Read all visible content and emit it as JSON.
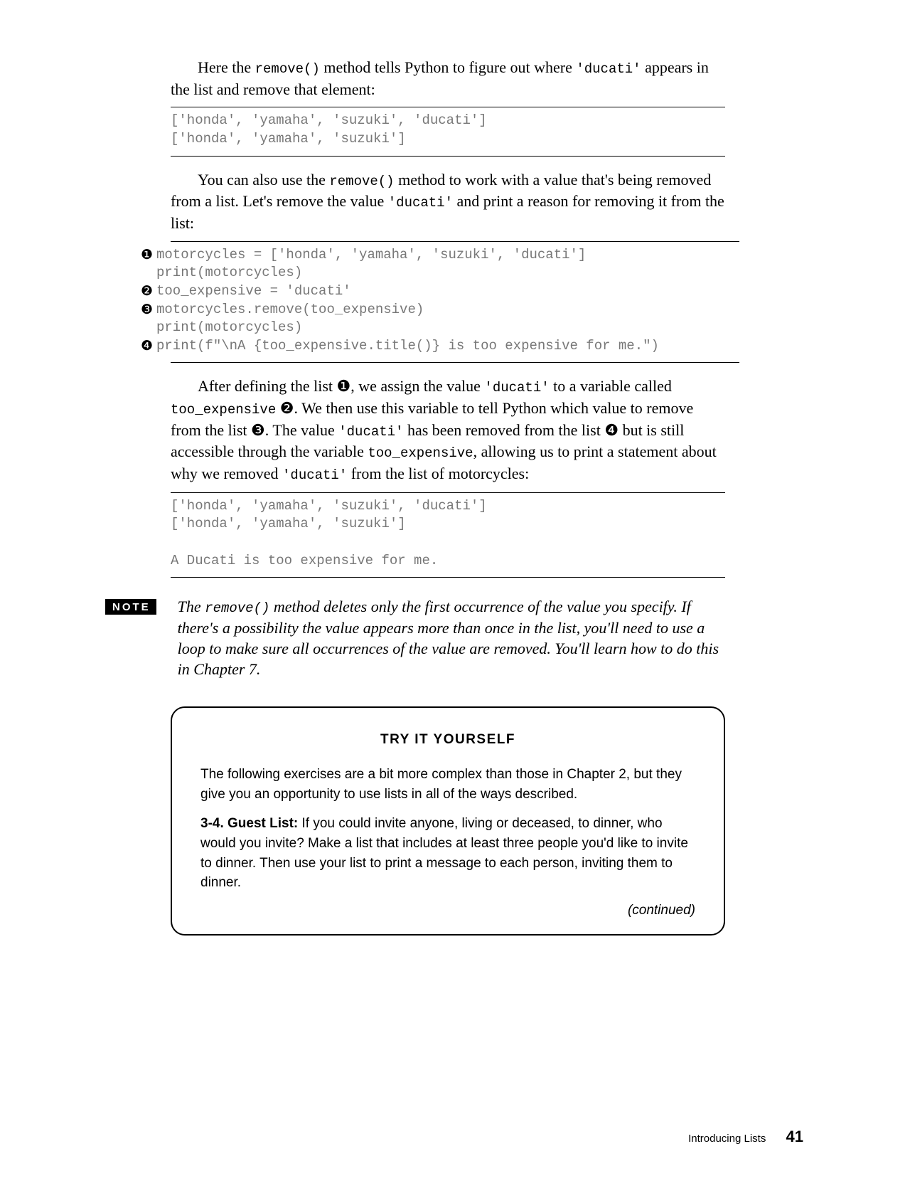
{
  "para1_a": "Here the ",
  "para1_code1": "remove()",
  "para1_b": " method tells Python to figure out where ",
  "para1_code2": "'ducati'",
  "para1_c": " appears in the list and remove that element:",
  "out1_l1": "['honda', 'yamaha', 'suzuki', 'ducati']",
  "out1_l2": "['honda', 'yamaha', 'suzuki']",
  "para2_a": "You can also use the ",
  "para2_code1": "remove()",
  "para2_b": " method to work with a value that's being removed from a list. Let's remove the value ",
  "para2_code2": "'ducati'",
  "para2_c": " and print a reason for removing it from the list:",
  "m1": "❶",
  "m2": "❷",
  "m3": "❸",
  "m4": "❹",
  "code_l1": "motorcycles = ['honda', 'yamaha', 'suzuki', 'ducati']",
  "code_l2": "print(motorcycles)",
  "code_blank": "",
  "code_l3": "too_expensive = 'ducati'",
  "code_l4": "motorcycles.remove(too_expensive)",
  "code_l5": "print(motorcycles)",
  "code_l6": "print(f\"\\nA {too_expensive.title()} is too expensive for me.\")",
  "para3_a": "After defining the list ",
  "para3_m1": "❶",
  "para3_b": ", we assign the value ",
  "para3_code1": "'ducati'",
  "para3_c": " to a variable called ",
  "para3_code2": "too_expensive",
  "para3_d": " ",
  "para3_m2": "❷",
  "para3_e": ". We then use this variable to tell Python which value to remove from the list ",
  "para3_m3": "❸",
  "para3_f": ". The value ",
  "para3_code3": "'ducati'",
  "para3_g": " has been removed from the list ",
  "para3_m4": "❹",
  "para3_h": " but is still accessible through the variable ",
  "para3_code4": "too_expensive",
  "para3_i": ", allow­ing us to print a statement about why we removed ",
  "para3_code5": "'ducati'",
  "para3_j": " from the list of motorcycles:",
  "out2_l1": "['honda', 'yamaha', 'suzuki', 'ducati']",
  "out2_l2": "['honda', 'yamaha', 'suzuki']",
  "out2_l3": "",
  "out2_l4": "A Ducati is too expensive for me.",
  "note_label": "NOTE",
  "note_a": "The ",
  "note_code1": "remove()",
  "note_b": " method deletes only the first occurrence of the value you specify. If there's a possibility the value appears more than once in the list, you'll need to use a loop to make sure all occurrences of the value are removed. You'll learn how to do this in Chapter 7.",
  "tiy_title": "TRY IT YOURSELF",
  "tiy_intro": "The following exercises are a bit more complex than those in Chapter 2, but they give you an opportunity to use lists in all of the ways described.",
  "tiy_ex_label": "3-4. Guest List:",
  "tiy_ex_body": " If you could invite anyone, living or deceased, to dinner, who would you invite? Make a list that includes at least three people you'd like to invite to dinner. Then use your list to print a message to each person, inviting them to dinner.",
  "tiy_cont": "(continued)",
  "footer_chapter": "Introducing Lists",
  "footer_page": "41"
}
